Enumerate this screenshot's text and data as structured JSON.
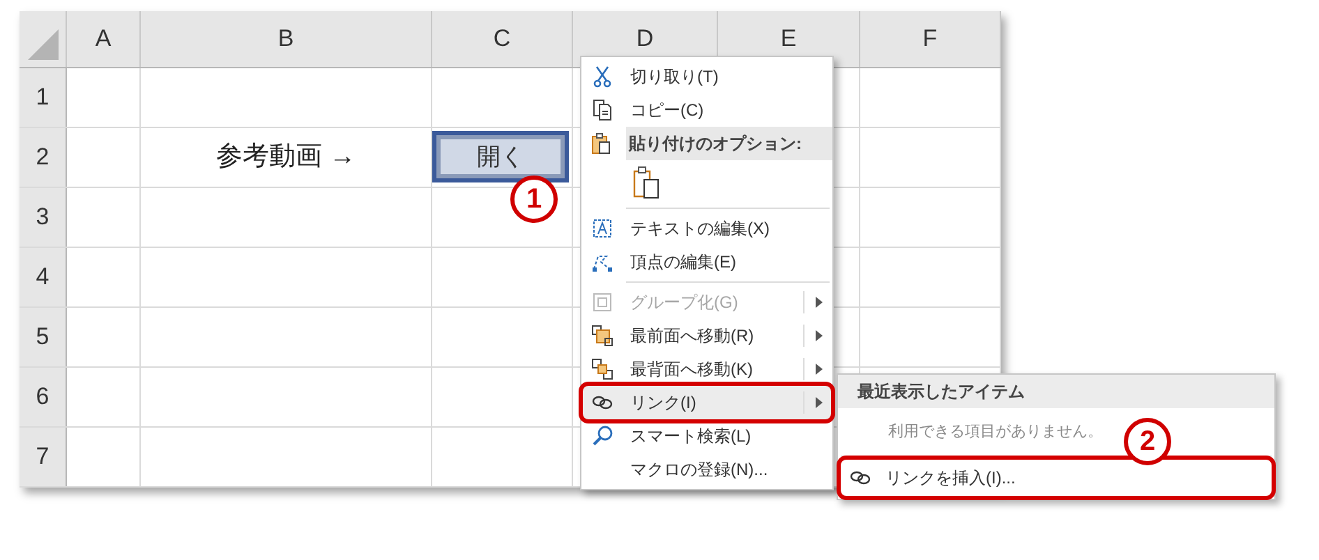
{
  "sheet": {
    "columns": [
      "A",
      "B",
      "C",
      "D",
      "E",
      "F"
    ],
    "rows": [
      {
        "header": "1",
        "cells": []
      },
      {
        "header": "2",
        "cells": [
          "",
          "参考動画 →"
        ]
      },
      {
        "header": "3",
        "cells": []
      },
      {
        "header": "4",
        "cells": []
      },
      {
        "header": "5",
        "cells": []
      },
      {
        "header": "6",
        "cells": []
      },
      {
        "header": "7",
        "cells": []
      }
    ],
    "shape_button": {
      "label": "開く",
      "selected": true
    }
  },
  "context_menu": {
    "items": [
      {
        "kind": "item",
        "label": "切り取り(T)",
        "disabled": false,
        "submenu": false,
        "highlighted": false,
        "annotated": false
      },
      {
        "kind": "item",
        "label": "コピー(C)",
        "disabled": false,
        "submenu": false,
        "highlighted": false,
        "annotated": false
      },
      {
        "kind": "header",
        "label": "貼り付けのオプション:"
      },
      {
        "kind": "paste-options"
      },
      {
        "kind": "separator"
      },
      {
        "kind": "item",
        "label": "テキストの編集(X)",
        "disabled": false,
        "submenu": false,
        "highlighted": false,
        "annotated": false
      },
      {
        "kind": "item",
        "label": "頂点の編集(E)",
        "disabled": false,
        "submenu": false,
        "highlighted": false,
        "annotated": false
      },
      {
        "kind": "separator"
      },
      {
        "kind": "item",
        "label": "グループ化(G)",
        "disabled": true,
        "submenu": true,
        "highlighted": false,
        "annotated": false
      },
      {
        "kind": "item",
        "label": "最前面へ移動(R)",
        "disabled": false,
        "submenu": true,
        "highlighted": false,
        "annotated": false
      },
      {
        "kind": "item",
        "label": "最背面へ移動(K)",
        "disabled": false,
        "submenu": true,
        "highlighted": false,
        "annotated": false
      },
      {
        "kind": "item",
        "label": "リンク(I)",
        "disabled": false,
        "submenu": true,
        "highlighted": true,
        "annotated": true
      },
      {
        "kind": "item",
        "label": "スマート検索(L)",
        "disabled": false,
        "submenu": false,
        "highlighted": false,
        "annotated": false
      },
      {
        "kind": "item",
        "label": "マクロの登録(N)...",
        "disabled": false,
        "submenu": false,
        "highlighted": false,
        "annotated": false
      }
    ]
  },
  "submenu": {
    "header": "最近表示したアイテム",
    "empty_message": "利用できる項目がありません。",
    "items": [
      {
        "label": "リンクを挿入(I)...",
        "annotated": true
      }
    ]
  },
  "callouts": [
    {
      "label": "1"
    },
    {
      "label": "2"
    }
  ]
}
